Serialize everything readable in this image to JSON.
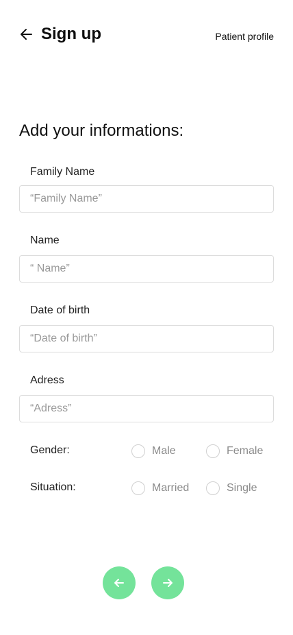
{
  "header": {
    "title": "Sign up",
    "profile_link": "Patient profile"
  },
  "form": {
    "section_title": "Add your informations:",
    "fields": [
      {
        "label": "Family Name",
        "value": "",
        "placeholder": "“Family Name”"
      },
      {
        "label": "Name",
        "value": "",
        "placeholder": "“ Name”"
      },
      {
        "label": "Date of birth",
        "value": "",
        "placeholder": "“Date of birth”"
      },
      {
        "label": "Adress",
        "value": "",
        "placeholder": "“Adress”"
      }
    ],
    "gender": {
      "label": "Gender:",
      "options": [
        "Male",
        "Female"
      ],
      "selected": ""
    },
    "situation": {
      "label": "Situation:",
      "options": [
        "Married",
        "Single"
      ],
      "selected": ""
    }
  },
  "icons": {
    "back": "arrow-left-icon",
    "prev": "arrow-left-icon",
    "next": "arrow-right-icon"
  },
  "colors": {
    "accent": "#74e39a",
    "input_border": "#dcdcdc",
    "placeholder": "#9a9a9a"
  }
}
